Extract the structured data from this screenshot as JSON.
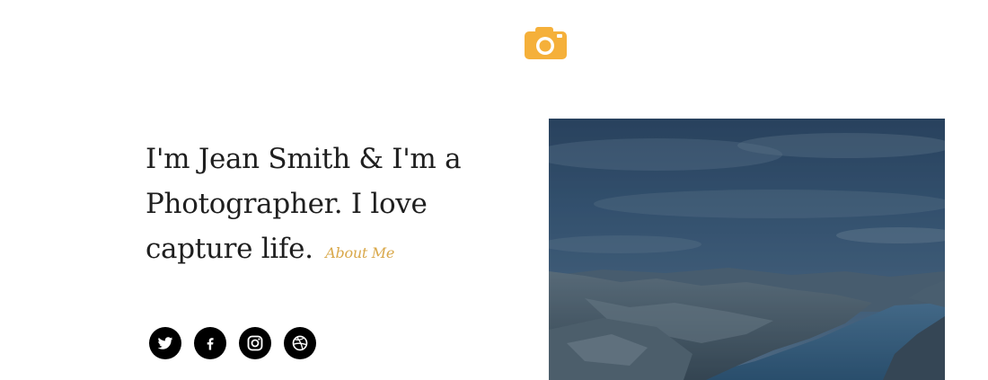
{
  "brand": {
    "icon": "camera-icon",
    "color": "#f5b03a"
  },
  "intro": {
    "line1": "I'm Jean Smith & I'm a",
    "line2": "Photographer. I love",
    "line3": "capture life.",
    "about_link": "About Me"
  },
  "social": [
    {
      "icon": "twitter-icon"
    },
    {
      "icon": "facebook-icon"
    },
    {
      "icon": "instagram-icon"
    },
    {
      "icon": "dribbble-icon"
    }
  ],
  "hero_image": {
    "subject": "fjord landscape"
  }
}
